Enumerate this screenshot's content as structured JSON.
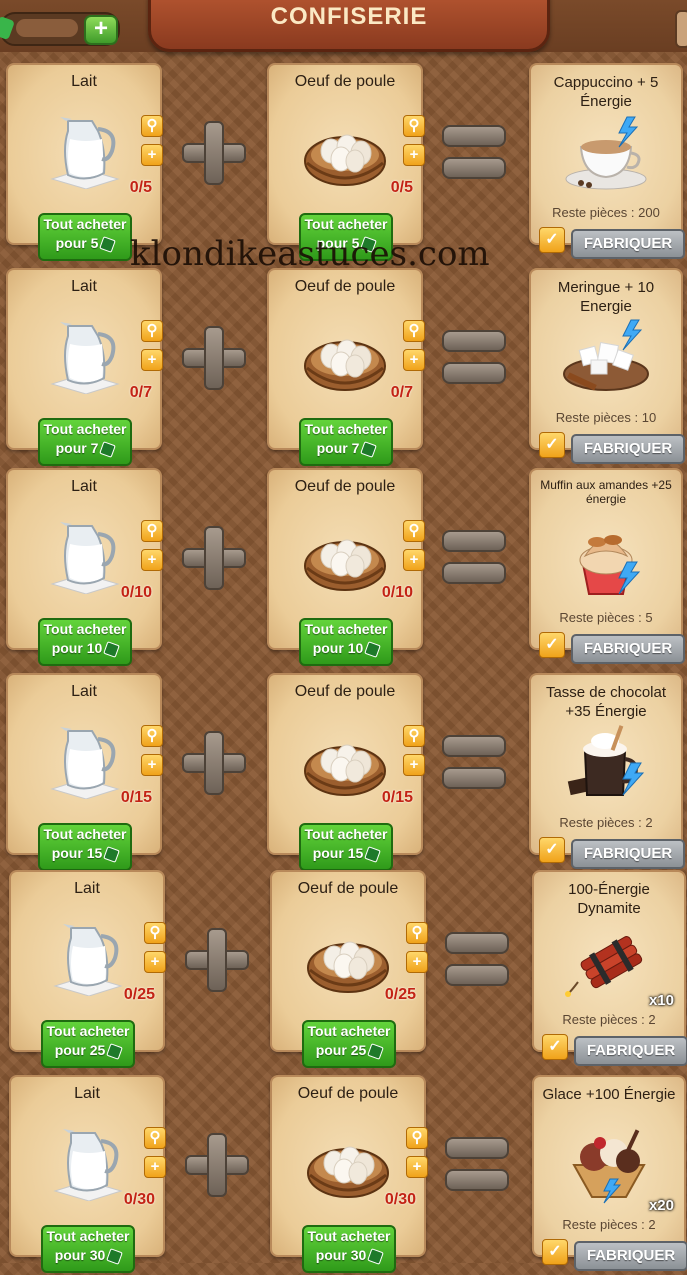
{
  "header": {
    "title": "CONFISERIE"
  },
  "watermark": "klondikeastuces.com",
  "labels": {
    "buy_line1": "Tout acheter",
    "make": "FABRIQUER"
  },
  "icons": {
    "search": "magnifier-icon",
    "add": "plus-icon",
    "make_check": "quill-check-icon",
    "gem": "green-gem-icon"
  },
  "rows": [
    {
      "ing1": {
        "name": "Lait",
        "count": "0/5",
        "buy2": "pour 5"
      },
      "ing2": {
        "name": "Oeuf de poule",
        "count": "0/5",
        "buy2": "pour 5"
      },
      "result": {
        "title": "Cappuccino + 5 Énergie",
        "remaining": "Reste pièces : 200",
        "qty": ""
      }
    },
    {
      "ing1": {
        "name": "Lait",
        "count": "0/7",
        "buy2": "pour 7"
      },
      "ing2": {
        "name": "Oeuf de poule",
        "count": "0/7",
        "buy2": "pour 7"
      },
      "result": {
        "title": "Meringue + 10 Energie",
        "remaining": "Reste pièces : 10",
        "qty": ""
      }
    },
    {
      "ing1": {
        "name": "Lait",
        "count": "0/10",
        "buy2": "pour 10"
      },
      "ing2": {
        "name": "Oeuf de poule",
        "count": "0/10",
        "buy2": "pour 10"
      },
      "result": {
        "title": "Muffin aux amandes +25 énergie",
        "remaining": "Reste pièces : 5",
        "qty": ""
      }
    },
    {
      "ing1": {
        "name": "Lait",
        "count": "0/15",
        "buy2": "pour 15"
      },
      "ing2": {
        "name": "Oeuf de poule",
        "count": "0/15",
        "buy2": "pour 15"
      },
      "result": {
        "title": "Tasse de chocolat +35 Énergie",
        "remaining": "Reste pièces : 2",
        "qty": ""
      }
    },
    {
      "ing1": {
        "name": "Lait",
        "count": "0/25",
        "buy2": "pour 25"
      },
      "ing2": {
        "name": "Oeuf de poule",
        "count": "0/25",
        "buy2": "pour 25"
      },
      "result": {
        "title": "100-Énergie Dynamite",
        "remaining": "Reste pièces : 2",
        "qty": "x10"
      }
    },
    {
      "ing1": {
        "name": "Lait",
        "count": "0/30",
        "buy2": "pour 30"
      },
      "ing2": {
        "name": "Oeuf de poule",
        "count": "0/30",
        "buy2": "pour 30"
      },
      "result": {
        "title": "Glace +100 Énergie",
        "remaining": "Reste pièces : 2",
        "qty": "x20"
      }
    }
  ]
}
